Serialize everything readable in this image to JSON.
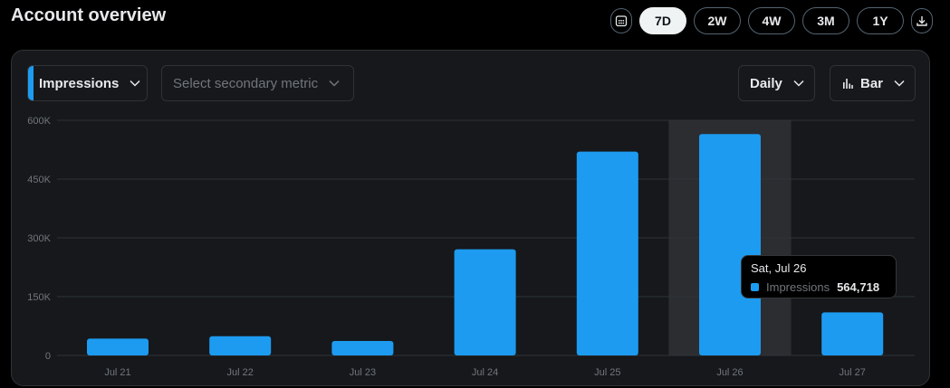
{
  "header": {
    "title": "Account overview"
  },
  "range_buttons": [
    "7D",
    "2W",
    "4W",
    "3M",
    "1Y"
  ],
  "active_range": "7D",
  "controls": {
    "metric": "Impressions",
    "secondary_placeholder": "Select secondary metric",
    "granularity": "Daily",
    "chart_type": "Bar"
  },
  "tooltip": {
    "date": "Sat, Jul 26",
    "series": "Impressions",
    "value": "564,718"
  },
  "colors": {
    "accent": "#1d9bf0",
    "hover_band": "#2b2d31"
  },
  "chart_data": {
    "type": "bar",
    "categories": [
      "Jul 21",
      "Jul 22",
      "Jul 23",
      "Jul 24",
      "Jul 25",
      "Jul 26",
      "Jul 27"
    ],
    "series": [
      {
        "name": "Impressions",
        "values": [
          43000,
          49000,
          37000,
          271000,
          520000,
          564718,
          110000
        ]
      }
    ],
    "ylim": [
      0,
      600000
    ],
    "yticks": [
      0,
      150000,
      300000,
      450000,
      600000
    ],
    "ytick_labels": [
      "0",
      "150K",
      "300K",
      "450K",
      "600K"
    ],
    "highlighted": "Jul 26",
    "grid": true
  }
}
